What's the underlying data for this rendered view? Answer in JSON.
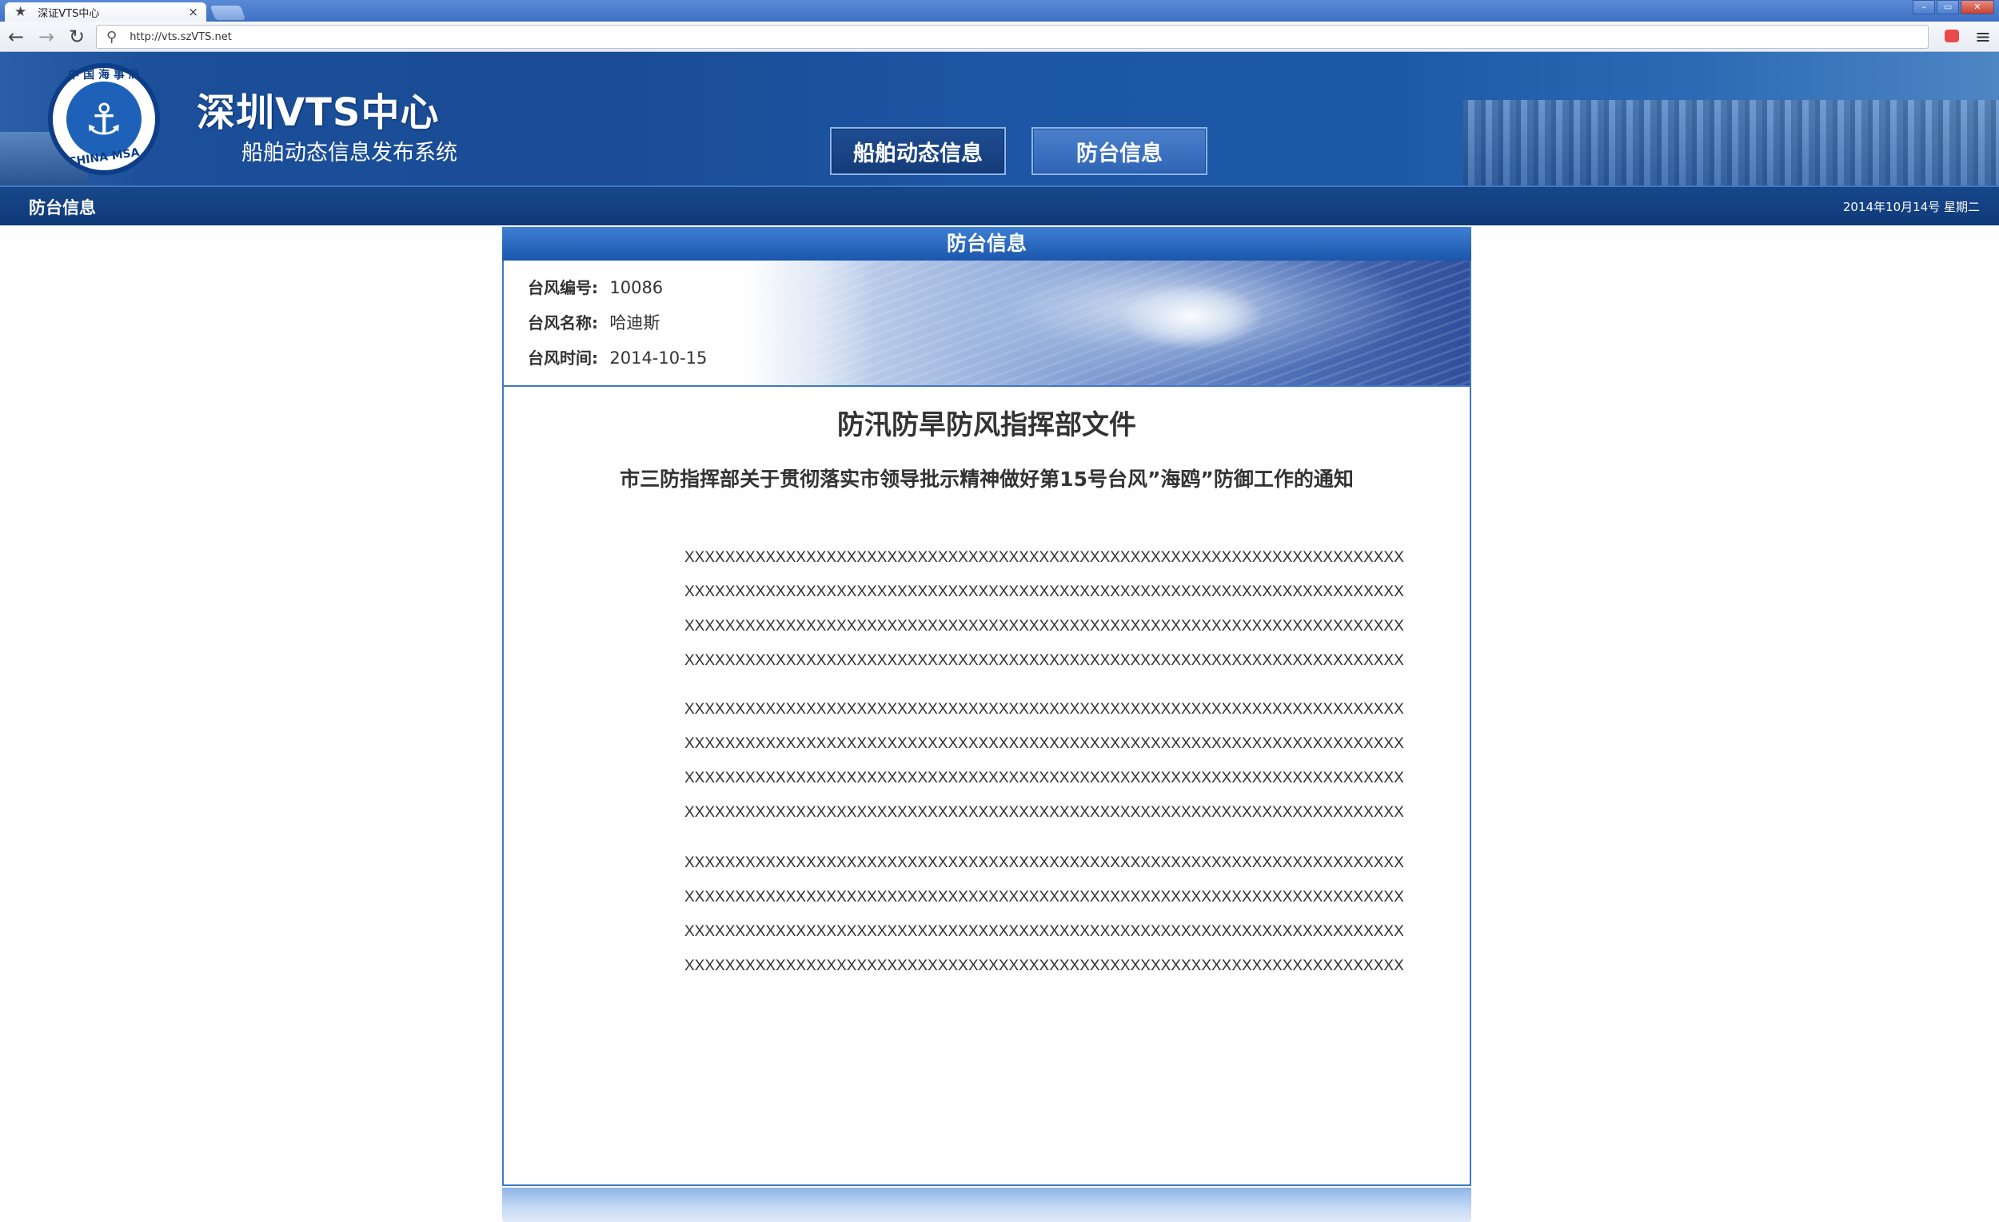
{
  "browser": {
    "tab_title": "深证VTS中心",
    "url": "http://vts.szVTS.net",
    "tab_close": "×"
  },
  "header": {
    "title": "深圳VTS中心",
    "subtitle": "船舶动态信息发布系统",
    "logo_text_top": "中 国 海 事 局",
    "logo_text_bottom": "CHINA MSA",
    "nav": [
      {
        "label": "船舶动态信息"
      },
      {
        "label": "防台信息"
      }
    ]
  },
  "subbar": {
    "section": "防台信息",
    "date": "2014年10月14号  星期二"
  },
  "panel": {
    "header": "防台信息",
    "info": [
      {
        "key": "台风编号",
        "value": "10086"
      },
      {
        "key": "台风名称",
        "value": "哈迪斯"
      },
      {
        "key": "台风时间",
        "value": "2014-10-15"
      }
    ],
    "doc_title": "防汛防旱防风指挥部文件",
    "doc_subtitle": "市三防指挥部关于贯彻落实市领导批示精神做好第15号台风”海鸥”防御工作的通知",
    "paragraphs": [
      [
        "XXXXXXXXXXXXXXXXXXXXXXXXXXXXXXXXXXXXXXXXXXXXXXXXXXXXXXXXXXXXXXXXXXXXXXX",
        "XXXXXXXXXXXXXXXXXXXXXXXXXXXXXXXXXXXXXXXXXXXXXXXXXXXXXXXXXXXXXXXXXXXXXXX",
        "XXXXXXXXXXXXXXXXXXXXXXXXXXXXXXXXXXXXXXXXXXXXXXXXXXXXXXXXXXXXXXXXXXXXXXX",
        "XXXXXXXXXXXXXXXXXXXXXXXXXXXXXXXXXXXXXXXXXXXXXXXXXXXXXXXXXXXXXXXXXXXXXXX"
      ],
      [
        "XXXXXXXXXXXXXXXXXXXXXXXXXXXXXXXXXXXXXXXXXXXXXXXXXXXXXXXXXXXXXXXXXXXXXXX",
        "XXXXXXXXXXXXXXXXXXXXXXXXXXXXXXXXXXXXXXXXXXXXXXXXXXXXXXXXXXXXXXXXXXXXXXX",
        "XXXXXXXXXXXXXXXXXXXXXXXXXXXXXXXXXXXXXXXXXXXXXXXXXXXXXXXXXXXXXXXXXXXXXXX",
        "XXXXXXXXXXXXXXXXXXXXXXXXXXXXXXXXXXXXXXXXXXXXXXXXXXXXXXXXXXXXXXXXXXXXXXX"
      ],
      [
        "XXXXXXXXXXXXXXXXXXXXXXXXXXXXXXXXXXXXXXXXXXXXXXXXXXXXXXXXXXXXXXXXXXXXXXX",
        "XXXXXXXXXXXXXXXXXXXXXXXXXXXXXXXXXXXXXXXXXXXXXXXXXXXXXXXXXXXXXXXXXXXXXXX",
        "XXXXXXXXXXXXXXXXXXXXXXXXXXXXXXXXXXXXXXXXXXXXXXXXXXXXXXXXXXXXXXXXXXXXXXX",
        "XXXXXXXXXXXXXXXXXXXXXXXXXXXXXXXXXXXXXXXXXXXXXXXXXXXXXXXXXXXXXXXXXXXXXXX"
      ]
    ]
  },
  "icons": {
    "favicon": "star-icon",
    "back": "arrow-left-icon",
    "forward": "arrow-right-icon",
    "reload": "reload-icon",
    "search": "search-icon",
    "menu": "hamburger-menu-icon"
  },
  "colors": {
    "header_blue": "#1a4c95",
    "subbar_blue": "#0f3a78",
    "panel_border": "#3f78c6"
  }
}
